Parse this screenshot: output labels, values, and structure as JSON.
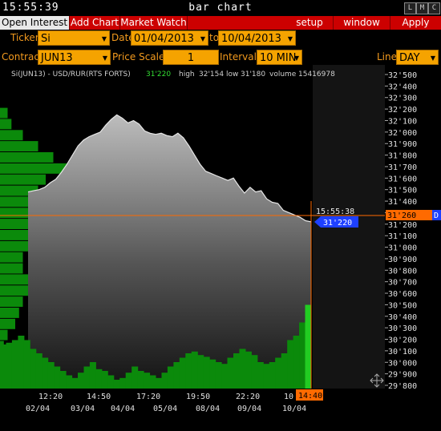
{
  "titlebar": {
    "clock": "15:55:39",
    "title": "bar chart",
    "buttons": [
      "L",
      "M",
      "C"
    ]
  },
  "menubar": {
    "open_interest": "Open Interest",
    "add_chart": "Add Chart",
    "market_watch": "Market Watch",
    "setup": "setup",
    "window": "window",
    "apply": "Apply"
  },
  "controls": {
    "ticker_label": "Ticker",
    "ticker_value": "Si",
    "date_label": "Date",
    "date_from": "01/04/2013",
    "to_label": "to",
    "date_to": "10/04/2013",
    "contract_label": "Contract",
    "contract_value": "JUN13",
    "price_scale_label": "Price Scale",
    "price_scale_value": "1",
    "interval_label": "Interval",
    "interval_value": "10 MIN",
    "line_label": "Line",
    "line_value": "DAY"
  },
  "info": {
    "instrument": "Si(JUN13) - USD/RUR(RTS FORTS)",
    "last": "31'220",
    "high_label": "high",
    "high": "32'154",
    "low_label": "low",
    "low": "31'180",
    "volume_label": "volume",
    "volume": "15416978"
  },
  "cursor": {
    "time": "15:55:38",
    "price_tag": "31'220",
    "line_price_tag": "31'260",
    "line_suffix": "D"
  },
  "colors": {
    "menu_red": "#cc0000",
    "field_orange": "#f5a300",
    "label_orange": "#f39a1e",
    "price_tag_blue": "#1e40ff",
    "volume_green": "#0b8a0b",
    "hline_orange": "#ff6a00"
  },
  "chart_data": {
    "type": "area",
    "title": "Si(JUN13) - USD/RUR(RTS FORTS)",
    "y_ticks": [
      "32'500",
      "32'400",
      "32'300",
      "32'200",
      "32'100",
      "32'000",
      "31'900",
      "31'800",
      "31'700",
      "31'600",
      "31'500",
      "31'400",
      "31'300",
      "31'200",
      "31'100",
      "31'000",
      "30'900",
      "30'800",
      "30'700",
      "30'600",
      "30'500",
      "30'400",
      "30'300",
      "30'200",
      "30'100",
      "30'000",
      "29'900",
      "29'800"
    ],
    "ylim": [
      29800,
      32500
    ],
    "x_time_ticks": [
      "12:20",
      "14:50",
      "17:20",
      "19:50",
      "22:20",
      "10"
    ],
    "x_date_ticks": [
      "02/04",
      "03/04",
      "04/04",
      "05/04",
      "08/04",
      "09/04",
      "10/04"
    ],
    "x_highlight": "14:40",
    "price_series": {
      "name": "Si(JUN13)",
      "values": [
        31480,
        31490,
        31500,
        31520,
        31560,
        31590,
        31650,
        31720,
        31800,
        31880,
        31930,
        31960,
        31980,
        32000,
        32060,
        32110,
        32150,
        32120,
        32080,
        32100,
        32070,
        32010,
        31990,
        31980,
        31990,
        31970,
        31960,
        31990,
        31950,
        31880,
        31800,
        31720,
        31660,
        31640,
        31620,
        31600,
        31580,
        31600,
        31530,
        31470,
        31520,
        31480,
        31490,
        31420,
        31390,
        31380,
        31320,
        31300,
        31280,
        31260,
        31230,
        31220
      ]
    },
    "volume_series": {
      "name": "volume",
      "values": [
        0.5,
        0.52,
        0.55,
        0.6,
        0.55,
        0.45,
        0.4,
        0.35,
        0.3,
        0.25,
        0.2,
        0.15,
        0.12,
        0.18,
        0.25,
        0.3,
        0.22,
        0.2,
        0.15,
        0.1,
        0.12,
        0.18,
        0.25,
        0.2,
        0.18,
        0.15,
        0.12,
        0.18,
        0.25,
        0.3,
        0.35,
        0.4,
        0.42,
        0.38,
        0.36,
        0.33,
        0.3,
        0.28,
        0.35,
        0.4,
        0.45,
        0.42,
        0.38,
        0.3,
        0.28,
        0.3,
        0.35,
        0.4,
        0.55,
        0.6,
        0.75,
        0.95
      ]
    },
    "profile_series": {
      "name": "volume profile",
      "values": [
        0.0,
        0.0,
        0.0,
        0.1,
        0.15,
        0.3,
        0.5,
        0.7,
        0.9,
        0.6,
        0.5,
        0.8,
        1.0,
        0.6,
        0.5,
        0.4,
        0.3,
        0.3,
        0.5,
        0.4,
        0.3,
        0.25,
        0.2,
        0.1,
        0.05,
        0.0,
        0.0,
        0.0
      ]
    }
  }
}
